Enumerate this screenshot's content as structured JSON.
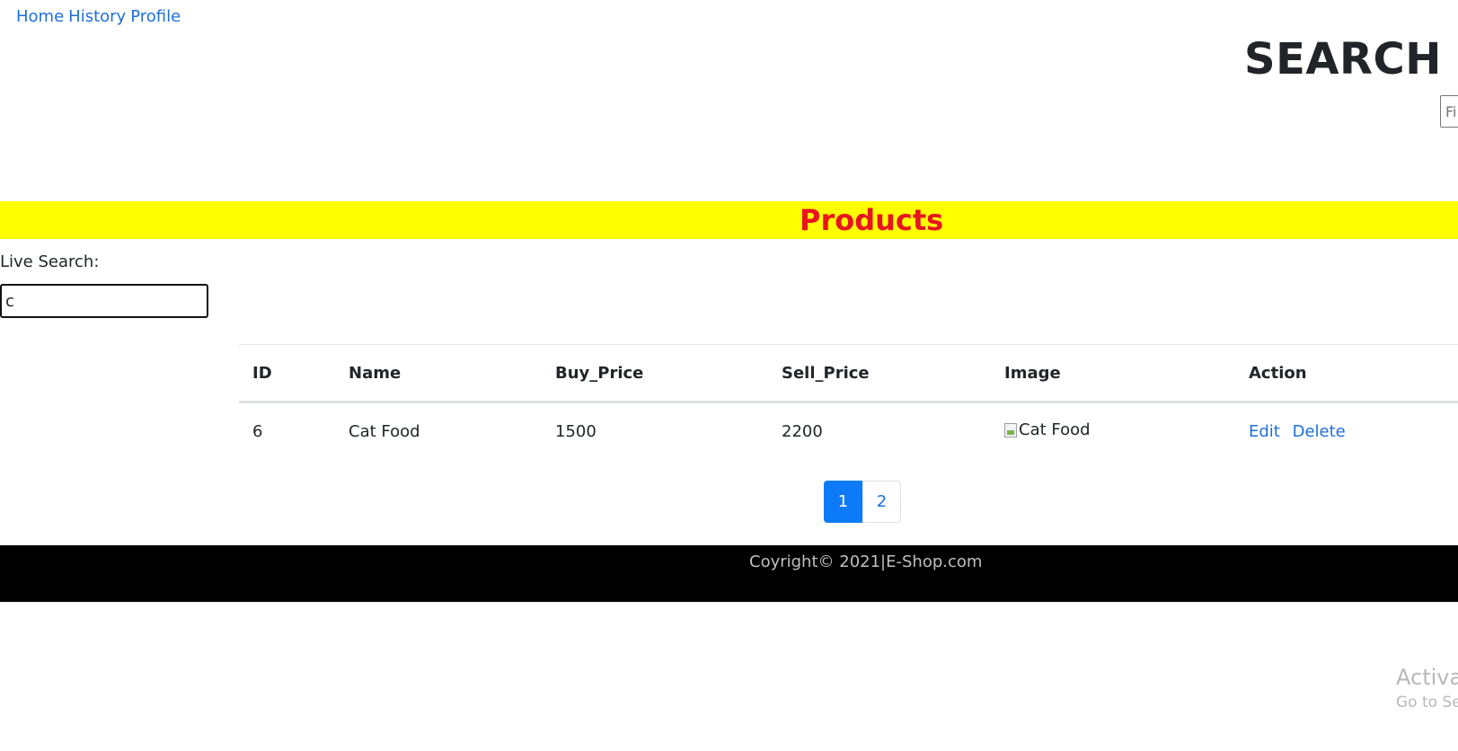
{
  "nav": {
    "home": "Home",
    "history": "History",
    "profile": "Profile"
  },
  "search_section": {
    "title": "SEARCH FO",
    "file_input_text": "Fi"
  },
  "banner": {
    "title": "Products",
    "bg_color": "#ffff00",
    "text_color": "#e8141f"
  },
  "live_search": {
    "label": "Live Search:",
    "value": "c"
  },
  "table": {
    "headers": {
      "id": "ID",
      "name": "Name",
      "buy_price": "Buy_Price",
      "sell_price": "Sell_Price",
      "image": "Image",
      "action": "Action"
    },
    "rows": [
      {
        "id": "6",
        "name": "Cat Food",
        "buy_price": "1500",
        "sell_price": "2200",
        "image_alt": "Cat Food",
        "edit": "Edit",
        "delete": "Delete"
      }
    ]
  },
  "pagination": {
    "page1": "1",
    "page2": "2",
    "active_color": "#0d7bf7"
  },
  "footer": {
    "text": "Coyright© 2021|E-Shop.com"
  },
  "watermark": {
    "line1": "Activat",
    "line2": "Go to Se"
  }
}
